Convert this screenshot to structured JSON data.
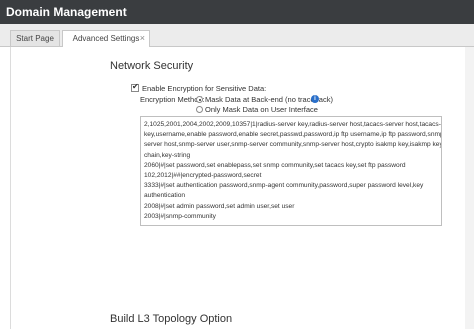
{
  "app": {
    "title": "Domain Management"
  },
  "tabs": [
    {
      "label": "Start Page"
    },
    {
      "label": "Advanced Settings",
      "close": "×"
    }
  ],
  "network_security": {
    "title": "Network Security",
    "enable_label": "Enable Encryption for Sensitive Data:",
    "enable_checked": true,
    "method_label": "Encryption Method:",
    "options": [
      {
        "label": "Mask Data at Back-end (no traceback)",
        "selected": true
      },
      {
        "label": "Only Mask Data on User Interface",
        "selected": false
      }
    ],
    "info_icon": "i",
    "rules_lines": [
      "2,1025,2001,2004,2002,2009,10357|1|radius-server key,radius-server host,tacacs-server host,tacacs-server",
      "key,username,enable password,enable secret,passwd,password,ip ftp username,ip ftp password,snmp-",
      "server host,snmp-server user,snmp-server community,snmp-server host,crypto isakmp key,isakmp key,key",
      "chain,key-string",
      "2060|#|set password,set enablepass,set snmp community,set tacacs key,set ftp password",
      "102,2012|##|encrypted-password,secret",
      "3333|#|set authentication password,snmp-agent community,password,super password level,key",
      "authentication",
      "2008|#|set admin password,set admin user,set user",
      "2003|#|snmp-community"
    ]
  },
  "l3": {
    "title": "Build L3 Topology Option"
  }
}
